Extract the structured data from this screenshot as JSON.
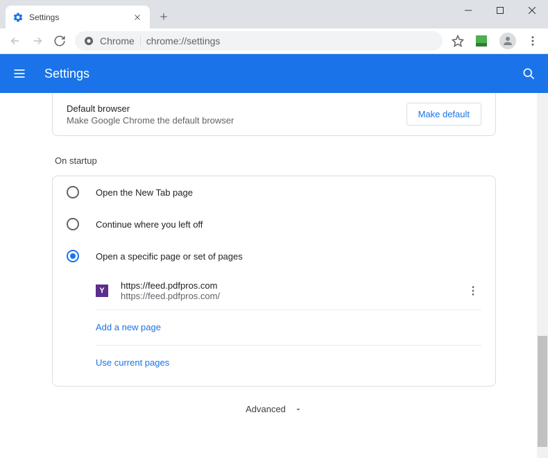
{
  "window": {
    "tab_title": "Settings"
  },
  "addrbar": {
    "chip": "Chrome",
    "url": "chrome://settings"
  },
  "appbar": {
    "title": "Settings"
  },
  "default_browser": {
    "title": "Default browser",
    "subtitle": "Make Google Chrome the default browser",
    "button": "Make default"
  },
  "startup": {
    "section_title": "On startup",
    "options": [
      {
        "label": "Open the New Tab page"
      },
      {
        "label": "Continue where you left off"
      },
      {
        "label": "Open a specific page or set of pages"
      }
    ],
    "page": {
      "title": "https://feed.pdfpros.com",
      "url": "https://feed.pdfpros.com/",
      "favicon_letter": "Y"
    },
    "add_new": "Add a new page",
    "use_current": "Use current pages"
  },
  "advanced": {
    "label": "Advanced"
  }
}
